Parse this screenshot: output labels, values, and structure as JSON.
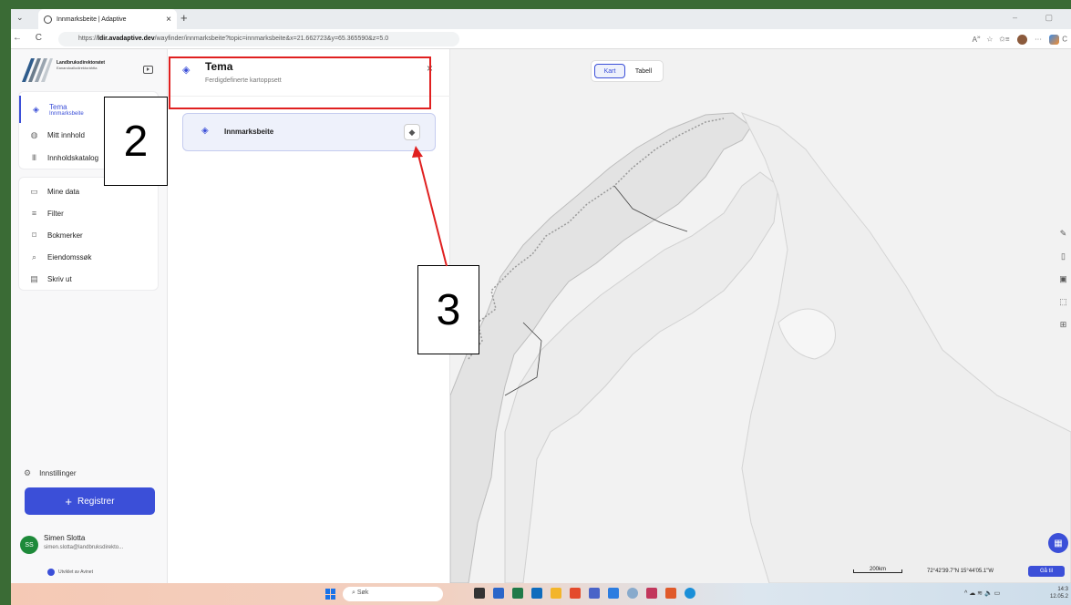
{
  "browser": {
    "tab_title": "Innmarksbeite | Adaptive",
    "url_prefix": "https://",
    "url_domain": "ldir.avadaptive.dev",
    "url_path": "/wayfinder/innmarksbeite?topic=innmarksbeite&x=21.662723&y=65.365590&z=5.0",
    "new_tab": "+",
    "tab_close": "×",
    "copilot_label": "C"
  },
  "logo": {
    "line1": "Landbruksdirektoratet",
    "line2": "Eanandoallodirektoráhtta"
  },
  "sidebar": {
    "tema_label": "Tema",
    "tema_sub": "Innmarksbeite",
    "mitt_innhold": "Mitt innhold",
    "innholdskatalog": "Innholdskatalog",
    "tools": [
      "Mine data",
      "Filter",
      "Bokmerker",
      "Eiendomssøk",
      "Skriv ut"
    ],
    "settings": "Innstillinger",
    "register": "Registrer",
    "register_icon": "+",
    "user": {
      "initials": "SS",
      "name": "Simen Slotta",
      "email": "simen.slotta@landbruksdirekto..."
    },
    "credit": "Utviklet av Avinet"
  },
  "panel": {
    "title": "Tema",
    "subtitle": "Ferdigdefinerte kartoppsett",
    "close": "×",
    "topic_label": "Innmarksbeite"
  },
  "map": {
    "view_toggle": [
      "Kart",
      "Tabell"
    ],
    "selected_view": "Kart",
    "scale_label": "200km",
    "coords": "72°42'39.7\"N 15°44'05.1\"W",
    "goto": "Gå til"
  },
  "annotations": {
    "step2": "2",
    "step3": "3",
    "color": "#e02020"
  },
  "taskbar": {
    "search": "Søk",
    "time": "14:3",
    "date": "12.05.2"
  },
  "colors": {
    "accent": "#3b4fd8",
    "avatar": "#1e8a3a",
    "desktop": "#3a6b35"
  }
}
